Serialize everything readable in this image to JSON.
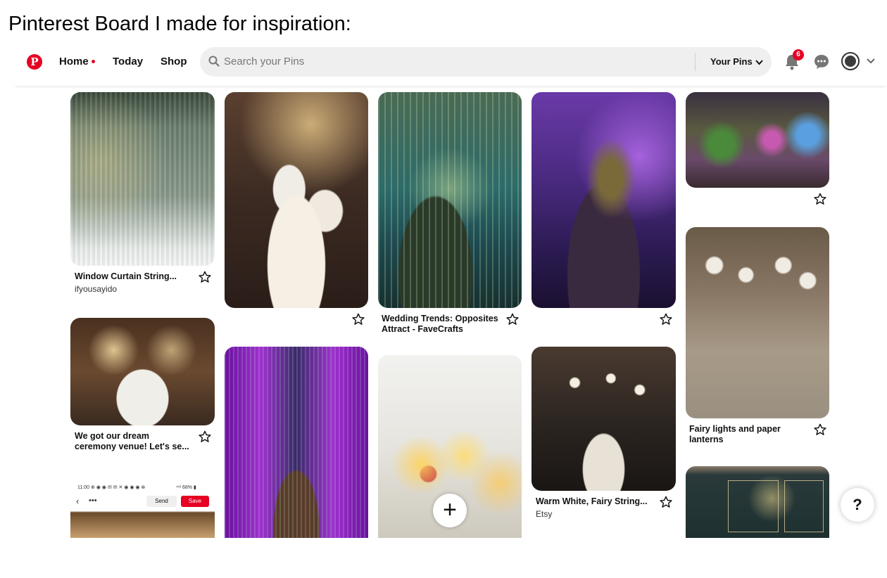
{
  "caption": "Pinterest Board I made for inspiration:",
  "header": {
    "logo_letter": "P",
    "nav": {
      "home": "Home",
      "today": "Today",
      "shop": "Shop"
    },
    "search": {
      "placeholder": "Search your Pins",
      "scope_label": "Your Pins"
    },
    "notifications_count": "6",
    "brand_color": "#e60023"
  },
  "pins": [
    {
      "id": "curtain",
      "title": "Window Curtain String...",
      "source": "ifyousayido",
      "icon": "star-icon"
    },
    {
      "id": "hall-1",
      "title": "",
      "source": "",
      "icon": ""
    },
    {
      "id": "teal-forest",
      "title": "Wedding Trends: Opposites Attract - FaveCrafts",
      "title_line1": "Wedding Trends: Opposites",
      "title_line2": "Attract - FaveCrafts",
      "icon": "star-icon"
    },
    {
      "id": "purple-tree",
      "title": "",
      "icon": "star-icon"
    },
    {
      "id": "garden",
      "title": "",
      "icon": "star-icon"
    },
    {
      "id": "venue",
      "title": "We got our dream ceremony venue! Let's se...",
      "title_line1": "We got our dream",
      "title_line2": "ceremony venue! Let's se...",
      "icon": "star-icon"
    },
    {
      "id": "violet-tunnel",
      "title": ""
    },
    {
      "id": "fairy-jars",
      "title": ""
    },
    {
      "id": "warm-white",
      "title": "Warm White, Fairy String...",
      "source": "Etsy",
      "icon": "star-icon"
    },
    {
      "id": "barn",
      "title": "Fairy lights and paper lanterns",
      "title_line1": "Fairy lights and paper",
      "title_line2": "lanterns",
      "icon": "star-icon"
    },
    {
      "id": "phone-screenshot",
      "status_left": "11:00 ⊕ ◉ ◉ ✉ ✉ ✕ ◉ ◉ ◉ ⊗",
      "status_right": "⁴⁶ᴵ 68% ▮",
      "send_label": "Send",
      "save_label": "Save"
    },
    {
      "id": "invite",
      "title": ""
    }
  ],
  "add_button_label": "+",
  "help_label": "?"
}
